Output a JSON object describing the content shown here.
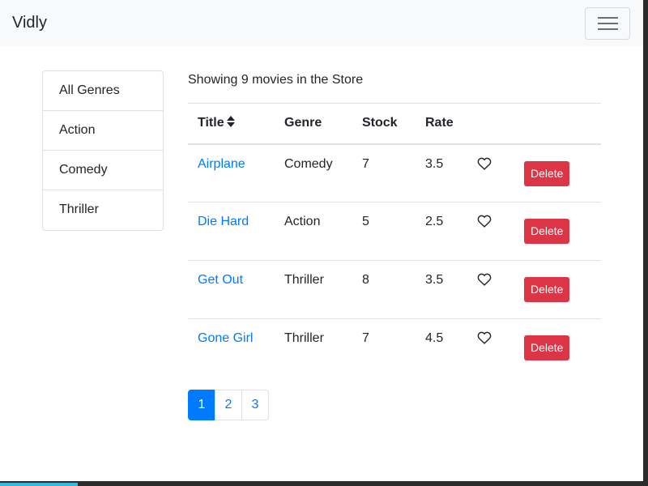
{
  "navbar": {
    "brand": "Vidly"
  },
  "genres": [
    {
      "label": "All Genres"
    },
    {
      "label": "Action"
    },
    {
      "label": "Comedy"
    },
    {
      "label": "Thriller"
    }
  ],
  "summary": "Showing 9 movies in the Store",
  "table": {
    "headers": {
      "title": "Title",
      "genre": "Genre",
      "stock": "Stock",
      "rate": "Rate"
    },
    "rows": [
      {
        "title": "Airplane",
        "genre": "Comedy",
        "stock": "7",
        "rate": "3.5",
        "delete_label": "Delete"
      },
      {
        "title": "Die Hard",
        "genre": "Action",
        "stock": "5",
        "rate": "2.5",
        "delete_label": "Delete"
      },
      {
        "title": "Get Out",
        "genre": "Thriller",
        "stock": "8",
        "rate": "3.5",
        "delete_label": "Delete"
      },
      {
        "title": "Gone Girl",
        "genre": "Thriller",
        "stock": "7",
        "rate": "4.5",
        "delete_label": "Delete"
      }
    ]
  },
  "pagination": {
    "pages": [
      "1",
      "2",
      "3"
    ],
    "active_page": "1"
  },
  "colors": {
    "primary": "#007bff",
    "danger": "#dc3545",
    "navbar_bg": "#f8f9fa"
  },
  "icons": {
    "sort": "sort-icon",
    "like": "heart-icon",
    "menu": "hamburger-icon"
  }
}
